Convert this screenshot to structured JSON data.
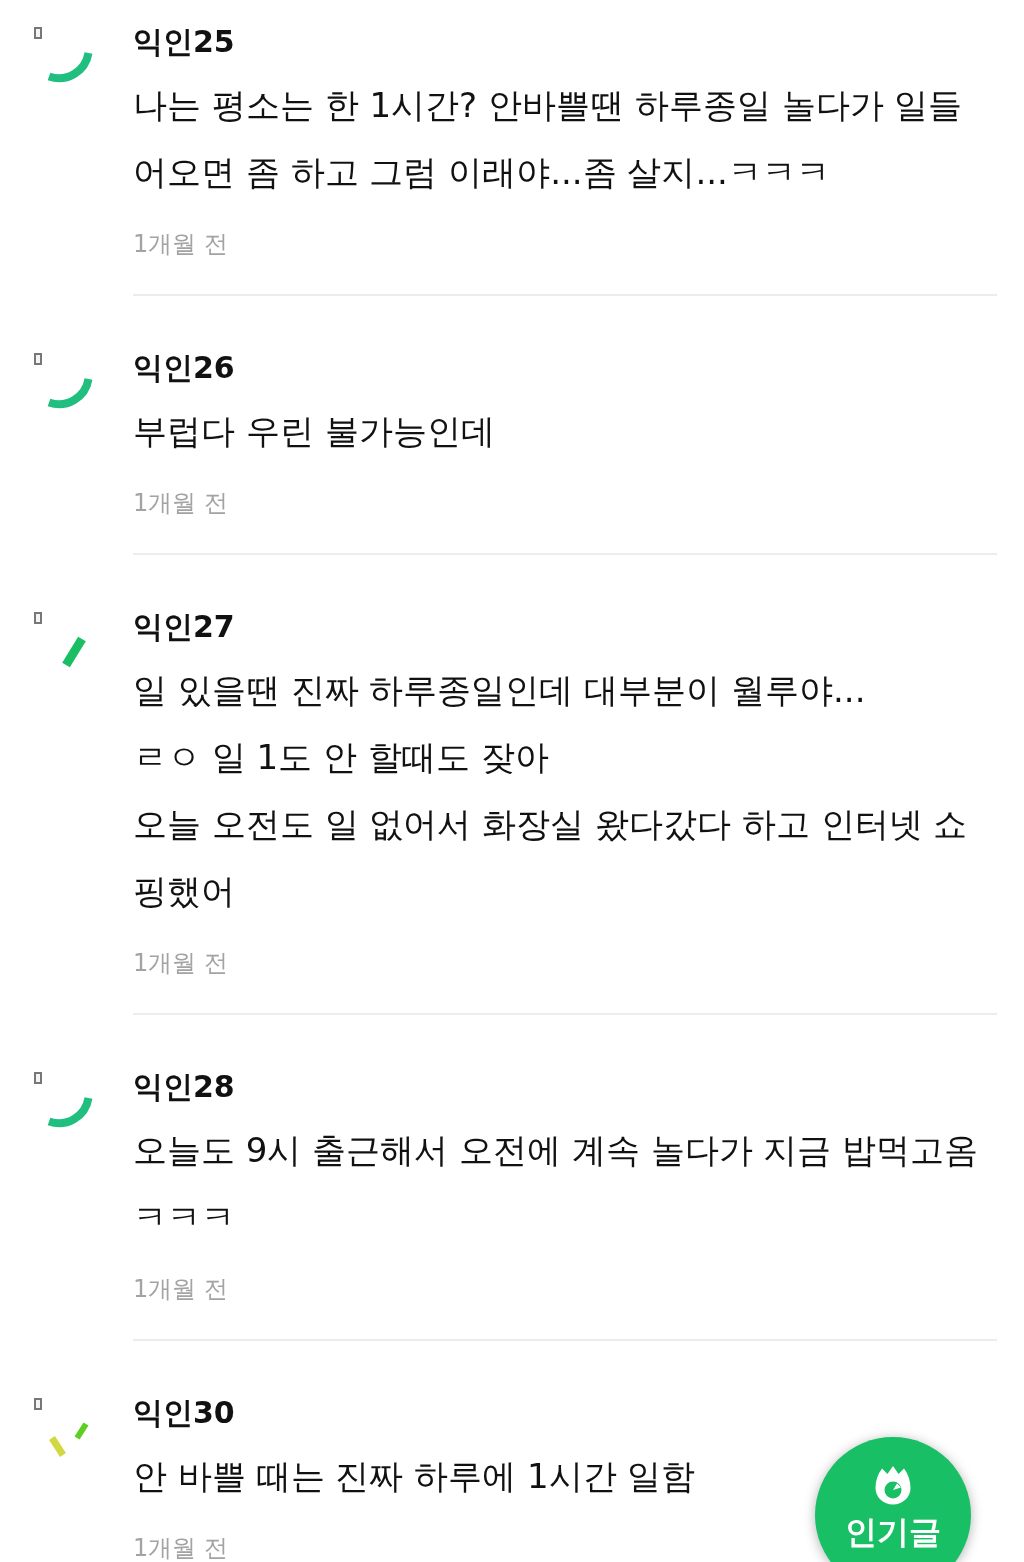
{
  "comments": [
    {
      "author": "익인25",
      "kind": "arc",
      "body": "나는 평소는 한 1시간? 안바쁠땐 하루종일 놀다가 일들\n어오면 좀 하고 그럼 이래야...좀 살지...ㅋㅋㅋ",
      "time": "1개월 전"
    },
    {
      "author": "익인26",
      "kind": "arc",
      "body": "부럽다 우린 불가능인데",
      "time": "1개월 전"
    },
    {
      "author": "익인27",
      "kind": "dash",
      "body": "일 있을땐 진짜 하루종일인데 대부분이 월루야...\nㄹㅇ 일 1도 안 할때도 잦아\n오늘 오전도 일 없어서 화장실 왔다갔다 하고 인터넷 쇼\n핑했어",
      "time": "1개월 전"
    },
    {
      "author": "익인28",
      "kind": "arc",
      "body": "오늘도 9시 출근해서 오전에 계속 놀다가 지금 밥먹고옴\nㅋㅋㅋ",
      "time": "1개월 전"
    },
    {
      "author": "익인30",
      "kind": "ticks",
      "body": "안 바쁠 때는 진짜 하루에 1시간 일함",
      "time": "1개월 전"
    }
  ],
  "floating_button": {
    "label": "인기글"
  }
}
